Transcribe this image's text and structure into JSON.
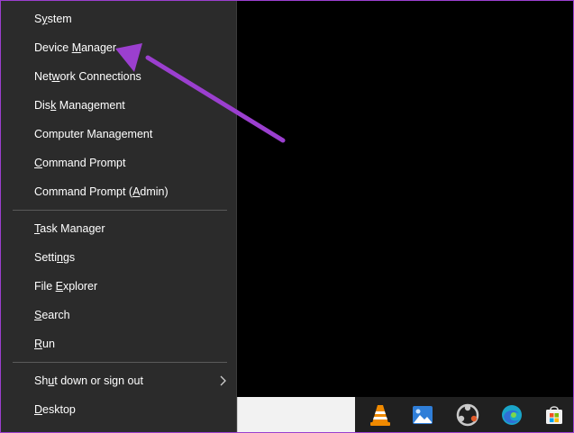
{
  "menu": {
    "group1": [
      {
        "pre": "S",
        "u": "y",
        "post": "stem"
      },
      {
        "pre": "Device ",
        "u": "M",
        "post": "anager"
      },
      {
        "pre": "Net",
        "u": "w",
        "post": "ork Connections"
      },
      {
        "pre": "Dis",
        "u": "k",
        "post": " Management"
      },
      {
        "pre": "Computer Mana",
        "u": "g",
        "post": "ement"
      },
      {
        "pre": "",
        "u": "C",
        "post": "ommand Prompt"
      },
      {
        "pre": "Command Prompt (",
        "u": "A",
        "post": "dmin)"
      }
    ],
    "group2": [
      {
        "pre": "",
        "u": "T",
        "post": "ask Manager"
      },
      {
        "pre": "Setti",
        "u": "n",
        "post": "gs"
      },
      {
        "pre": "File ",
        "u": "E",
        "post": "xplorer"
      },
      {
        "pre": "",
        "u": "S",
        "post": "earch"
      },
      {
        "pre": "",
        "u": "R",
        "post": "un"
      }
    ],
    "group3": [
      {
        "pre": "Sh",
        "u": "u",
        "post": "t down or sign out",
        "submenu": true
      },
      {
        "pre": "",
        "u": "D",
        "post": "esktop"
      }
    ]
  },
  "taskbar": {
    "icons": [
      "vlc-icon",
      "photos-icon",
      "obs-icon",
      "edge-icon",
      "store-icon"
    ]
  },
  "colors": {
    "menu_bg": "#2b2b2b",
    "annotation_arrow": "#9b3fcf"
  }
}
